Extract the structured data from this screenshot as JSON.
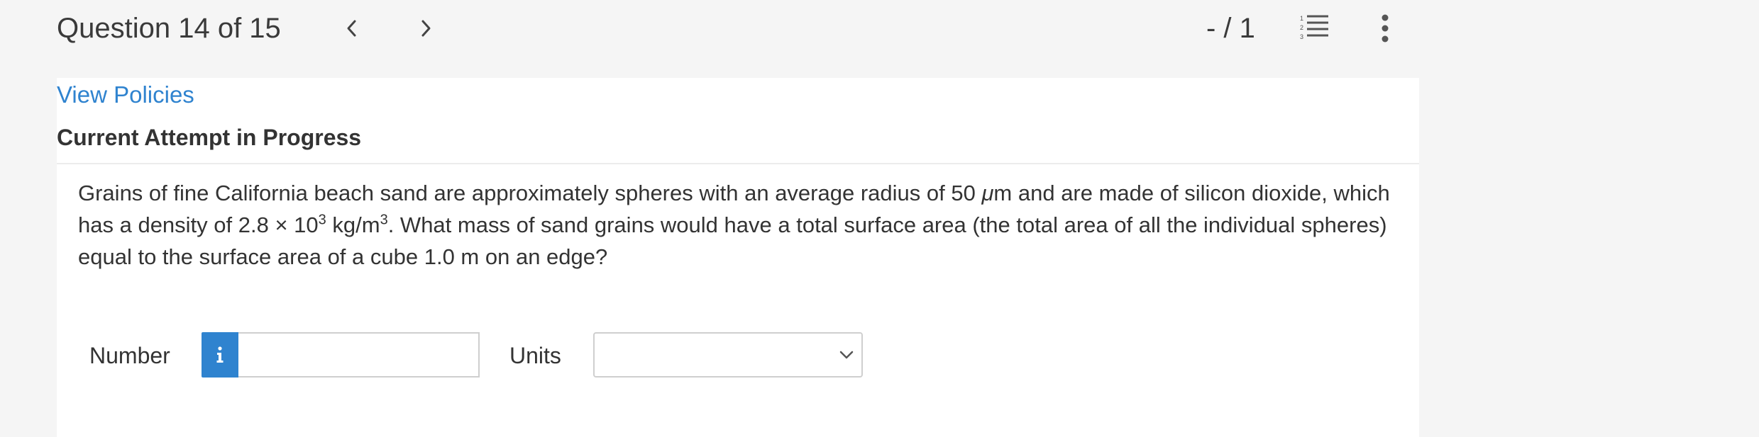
{
  "header": {
    "question_label": "Question 14 of 15",
    "score": "- / 1",
    "prev_icon": "chevron-left-icon",
    "next_icon": "chevron-right-icon",
    "list_icon": "numbered-list-icon",
    "more_icon": "vertical-ellipsis-icon"
  },
  "links": {
    "view_policies": "View Policies"
  },
  "attempt": {
    "heading": "Current Attempt in Progress"
  },
  "question": {
    "part1": "Grains of fine California beach sand are approximately spheres with an average radius of 50 ",
    "mu": "μ",
    "part2": "m and are made of silicon dioxide, which has a density of 2.8 × 10",
    "exp1": "3",
    "part3": " kg/m",
    "exp2": "3",
    "part4": ". What mass of sand grains would have a total surface area (the total area of all the individual spheres) equal to the surface area of a cube 1.0 m on an edge?"
  },
  "answer": {
    "number_label": "Number",
    "number_value": "",
    "units_label": "Units",
    "units_selected": ""
  },
  "colors": {
    "accent": "#2f83cf",
    "page_bg": "#f5f5f5",
    "panel_bg": "#ffffff"
  }
}
